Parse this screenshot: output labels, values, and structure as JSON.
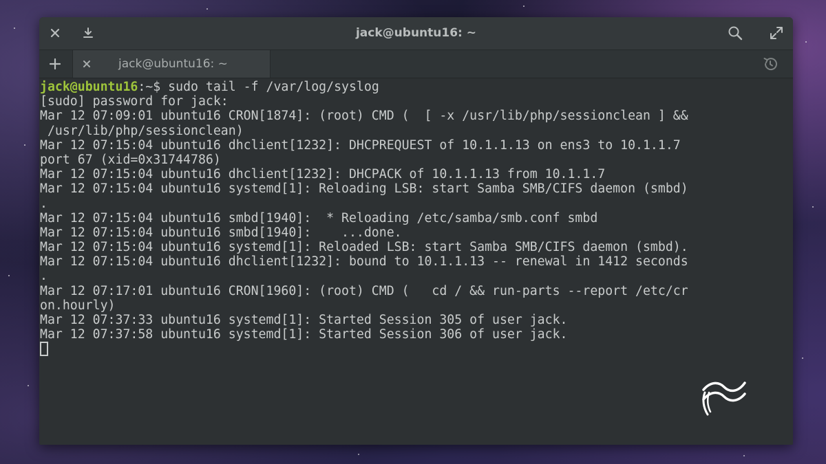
{
  "window": {
    "title": "jack@ubuntu16: ~"
  },
  "tabs": [
    {
      "label": "jack@ubuntu16: ~",
      "active": true
    }
  ],
  "icons": {
    "close": "close-icon",
    "download": "download-icon",
    "search": "search-icon",
    "maximize": "maximize-icon",
    "new_tab": "plus-icon",
    "tab_close": "close-icon",
    "history": "history-icon",
    "watermark": "wave-logo-icon"
  },
  "colors": {
    "prompt_user": "#9fc53b",
    "terminal_bg": "#2d3133",
    "terminal_fg": "#c9cccc"
  },
  "terminal": {
    "prompt_user": "jack@ubuntu16",
    "prompt_path": ":~$ ",
    "command": "sudo tail -f /var/log/syslog",
    "output": [
      "[sudo] password for jack:",
      "Mar 12 07:09:01 ubuntu16 CRON[1874]: (root) CMD (  [ -x /usr/lib/php/sessionclean ] &&",
      " /usr/lib/php/sessionclean)",
      "Mar 12 07:15:04 ubuntu16 dhclient[1232]: DHCPREQUEST of 10.1.1.13 on ens3 to 10.1.1.7",
      "port 67 (xid=0x31744786)",
      "Mar 12 07:15:04 ubuntu16 dhclient[1232]: DHCPACK of 10.1.1.13 from 10.1.1.7",
      "Mar 12 07:15:04 ubuntu16 systemd[1]: Reloading LSB: start Samba SMB/CIFS daemon (smbd)",
      ".",
      "Mar 12 07:15:04 ubuntu16 smbd[1940]:  * Reloading /etc/samba/smb.conf smbd",
      "Mar 12 07:15:04 ubuntu16 smbd[1940]:    ...done.",
      "Mar 12 07:15:04 ubuntu16 systemd[1]: Reloaded LSB: start Samba SMB/CIFS daemon (smbd).",
      "Mar 12 07:15:04 ubuntu16 dhclient[1232]: bound to 10.1.1.13 -- renewal in 1412 seconds",
      ".",
      "Mar 12 07:17:01 ubuntu16 CRON[1960]: (root) CMD (   cd / && run-parts --report /etc/cr",
      "on.hourly)",
      "Mar 12 07:37:33 ubuntu16 systemd[1]: Started Session 305 of user jack.",
      "Mar 12 07:37:58 ubuntu16 systemd[1]: Started Session 306 of user jack."
    ]
  }
}
